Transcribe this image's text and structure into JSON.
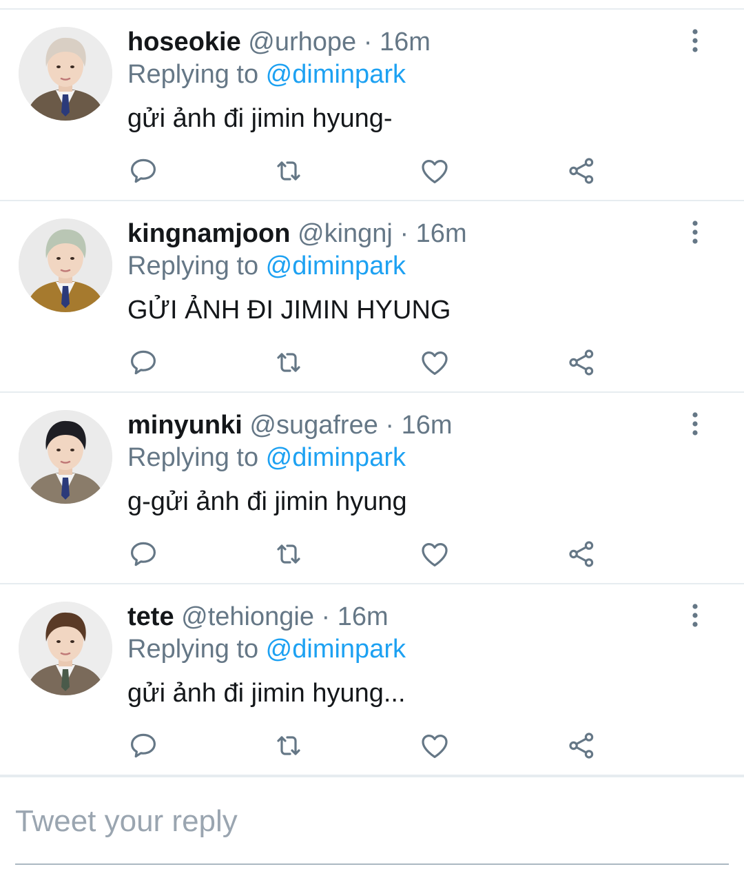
{
  "tweets": [
    {
      "display_name": "hoseokie",
      "handle": "@urhope",
      "separator": "·",
      "time": "16m",
      "replying_prefix": "Replying to ",
      "replying_to": "@diminpark",
      "text": "gửi ảnh đi jimin hyung-",
      "avatar": {
        "hair": "#d9cfc4",
        "jacket": "#6b5a48",
        "bg": "#ececec",
        "tie": "#2b3a7a"
      }
    },
    {
      "display_name": "kingnamjoon",
      "handle": "@kingnj",
      "separator": "·",
      "time": "16m",
      "replying_prefix": "Replying to ",
      "replying_to": "@diminpark",
      "text": "GỬI ẢNH ĐI JIMIN HYUNG",
      "avatar": {
        "hair": "#b9c6b4",
        "jacket": "#a67a2e",
        "bg": "#eaeaea",
        "tie": "#2b3a7a"
      }
    },
    {
      "display_name": "minyunki",
      "handle": "@sugafree",
      "separator": "·",
      "time": "16m",
      "replying_prefix": "Replying to ",
      "replying_to": "@diminpark",
      "text": "g-gửi ảnh đi jimin hyung",
      "avatar": {
        "hair": "#1e1e24",
        "jacket": "#8a7c6a",
        "bg": "#ebebeb",
        "tie": "#2b3a7a"
      }
    },
    {
      "display_name": "tete",
      "handle": "@tehiongie",
      "separator": "·",
      "time": "16m",
      "replying_prefix": "Replying to ",
      "replying_to": "@diminpark",
      "text": "gửi ảnh đi jimin hyung...",
      "avatar": {
        "hair": "#5a3a26",
        "jacket": "#7a6a5a",
        "bg": "#ededed",
        "tie": "#4a5a4a"
      }
    }
  ],
  "icons": {
    "reply": "reply-icon",
    "retweet": "retweet-icon",
    "like": "heart-icon",
    "share": "share-icon",
    "more": "more-vertical-icon"
  },
  "colors": {
    "link": "#1da1f2",
    "secondary_text": "#657786",
    "primary_text": "#14171a",
    "icon": "#657786",
    "divider": "#e6ecf0"
  },
  "reply_box": {
    "placeholder": "Tweet your reply"
  }
}
